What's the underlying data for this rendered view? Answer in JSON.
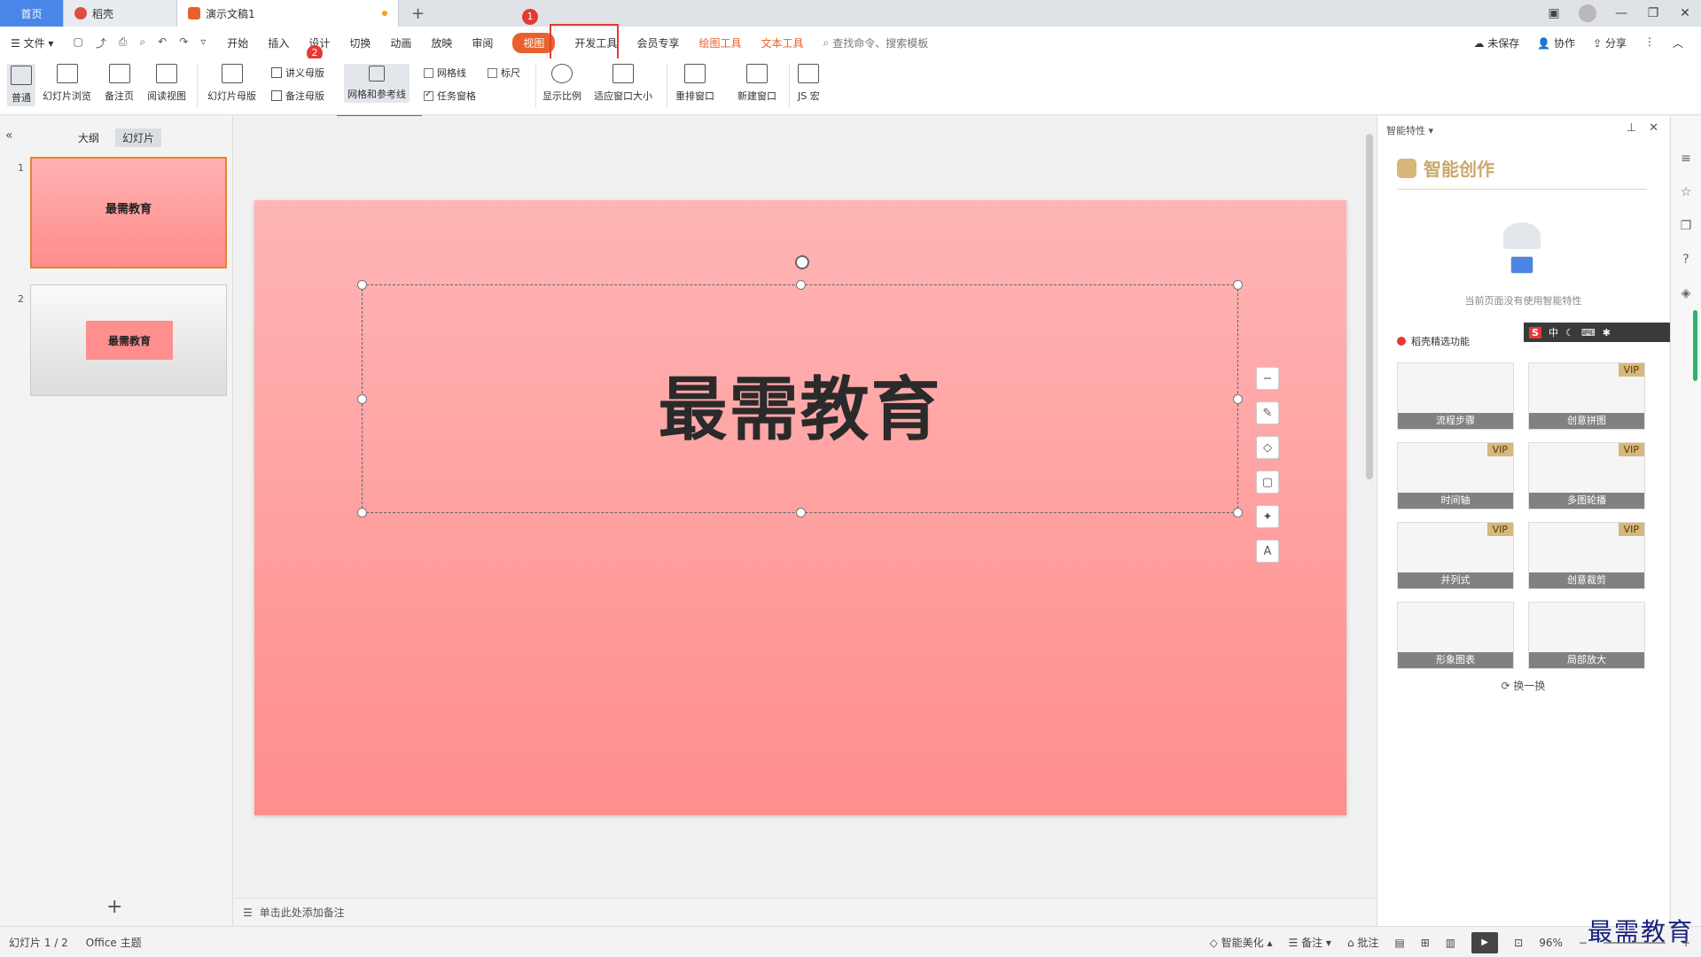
{
  "tabs": {
    "home": "首页",
    "daoke": "稻壳",
    "doc": "演示文稿1"
  },
  "menu": {
    "file": "文件",
    "items": [
      "开始",
      "插入",
      "设计",
      "切换",
      "动画",
      "放映",
      "审阅"
    ],
    "active": "视图",
    "items2": [
      "开发工具",
      "会员专享"
    ],
    "orange": [
      "绘图工具",
      "文本工具"
    ],
    "search": "查找命令、搜索模板",
    "right": [
      "未保存",
      "协作",
      "分享"
    ]
  },
  "ribbon": {
    "normal": "普通",
    "slide_browse": "幻灯片浏览",
    "notes_page": "备注页",
    "reading_view": "阅读视图",
    "slide_master": "幻灯片母版",
    "handout_master": "讲义母版",
    "notes_master": "备注母版",
    "grid_guides": "网格和参考线",
    "gridlines": "网格线",
    "ruler": "标尺",
    "task_pane": "任务窗格",
    "zoom": "显示比例",
    "fit_window": "适应窗口大小",
    "rearrange": "重排窗口",
    "new_window": "新建窗口",
    "js_macro": "JS 宏"
  },
  "badges": {
    "b1": "1",
    "b2": "2"
  },
  "leftpanel": {
    "outline": "大纲",
    "slides": "幻灯片",
    "n1": "1",
    "n2": "2",
    "thumb1": "最需教育",
    "thumb2": "最需教育",
    "add": "+"
  },
  "slide": {
    "title": "最需教育"
  },
  "notes": {
    "placeholder": "单击此处添加备注"
  },
  "rightpanel": {
    "header": "智能特性",
    "title": "智能创作",
    "empty": "当前页面没有使用智能特性",
    "section": "稻壳精选功能",
    "cards": [
      "流程步骤",
      "创意拼图",
      "时间轴",
      "多图轮播",
      "并列式",
      "创意裁剪",
      "形象图表",
      "局部放大"
    ],
    "vip": "VIP",
    "swap": "换一换"
  },
  "ime": {
    "s": "S",
    "zh": "中"
  },
  "status": {
    "slide_count": "幻灯片 1 / 2",
    "theme": "Office 主题",
    "beautify": "智能美化",
    "notes": "备注",
    "comments": "批注",
    "zoom": "96%"
  },
  "watermark": "最需教育"
}
